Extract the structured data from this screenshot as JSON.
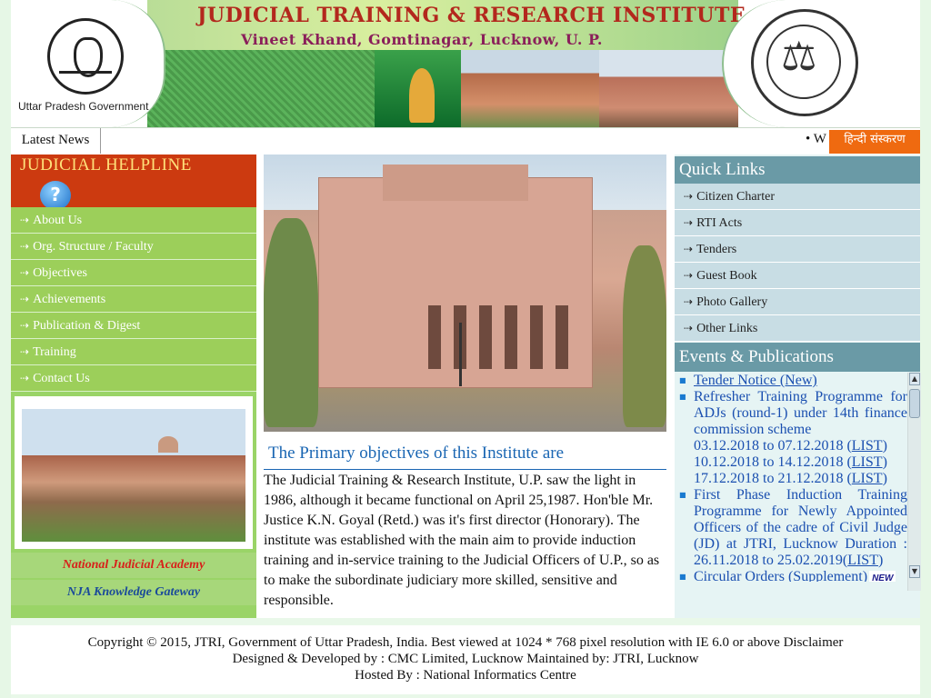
{
  "header": {
    "title": "JUDICIAL TRAINING & RESEARCH INSTITUTE",
    "subtitle": "Vineet Khand, Gomtinagar, Lucknow, U. P.",
    "left_caption": "Uttar Pradesh Government",
    "right_logo_icon": "judicial-seal-icon",
    "left_logo_icon": "up-emblem-icon"
  },
  "newsbar": {
    "label": "Latest News",
    "ticker_text": "• W",
    "hindi_button": "हिन्दी संस्करण"
  },
  "left": {
    "helpline_title": "JUDICIAL HELPLINE",
    "helpline_icon": "question-icon",
    "menu": [
      {
        "label": "About Us"
      },
      {
        "label": "Org. Structure / Faculty"
      },
      {
        "label": "Objectives"
      },
      {
        "label": "Achievements"
      },
      {
        "label": "Publication & Digest"
      },
      {
        "label": "Training"
      },
      {
        "label": "Contact Us"
      }
    ],
    "nja_link": "National Judicial Academy",
    "nja_gateway": "NJA Knowledge Gateway"
  },
  "main": {
    "heading": "The Primary objectives of this Institute are",
    "body": "The Judicial Training & Research Institute, U.P. saw the light in 1986, although it became functional on April 25,1987. Hon'ble Mr. Justice K.N. Goyal (Retd.) was it's first director (Honorary). The institute was established with the main aim to provide induction training and in-service training to the Judicial Officers of U.P., so as to make the subordinate judiciary more skilled, sensitive and responsible."
  },
  "right": {
    "quick_links_title": "Quick Links",
    "quick_links": [
      {
        "label": "Citizen Charter"
      },
      {
        "label": "RTI Acts"
      },
      {
        "label": "Tenders"
      },
      {
        "label": "Guest Book"
      },
      {
        "label": "Photo Gallery"
      },
      {
        "label": "Other Links"
      }
    ],
    "events_title": "Events & Publications",
    "events": {
      "item1": "Tender Notice (New)",
      "item2_text": "Refresher Training Programme for ADJs (round-1) under 14th finance commission scheme",
      "item2_dates": [
        {
          "range": "03.12.2018 to 07.12.2018",
          "link": "LIST"
        },
        {
          "range": "10.12.2018 to 14.12.2018",
          "link": "LIST"
        },
        {
          "range": "17.12.2018 to 21.12.2018",
          "link": "LIST"
        }
      ],
      "item3_text": "First Phase Induction Training Programme for Newly Appointed Officers of the cadre of Civil Judge (JD) at JTRI, Lucknow Duration : 26.11.2018 to 25.02.2019",
      "item3_link": "LIST",
      "item4": "Circular Orders (Supplement)",
      "new_badge": "NEW"
    }
  },
  "footer": {
    "line1": "Copyright © 2015, JTRI, Government of Uttar Pradesh, India. Best viewed at 1024 * 768 pixel resolution with IE 6.0 or above Disclaimer",
    "line2": "Designed & Developed by : CMC Limited, Lucknow Maintained by: JTRI, Lucknow",
    "line3": "Hosted By : National Informatics Centre"
  },
  "colors": {
    "helpline_bg": "#cc3a10",
    "menu_green": "#9ccf5a",
    "panel_head": "#6a9aa6",
    "hindi_button": "#ef6a10",
    "link_blue": "#1a4fb0"
  }
}
